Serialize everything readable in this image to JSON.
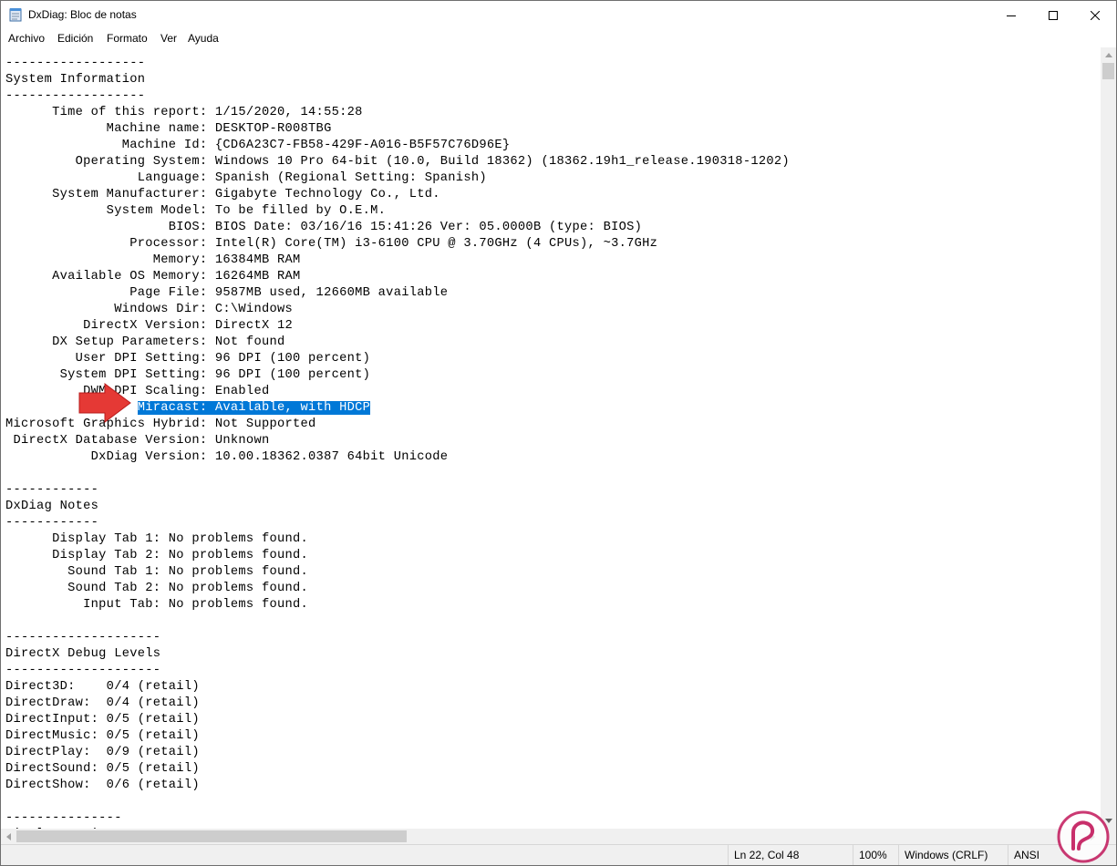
{
  "window": {
    "title": "DxDiag: Bloc de notas",
    "icon": "notepad-icon",
    "controls": [
      "minimize-icon",
      "maximize-icon",
      "close-icon"
    ]
  },
  "menu": {
    "items": [
      "Archivo",
      "Edición",
      "Formato",
      "Ver",
      "Ayuda"
    ]
  },
  "document": {
    "lines": [
      "------------------",
      "System Information",
      "------------------",
      "      Time of this report: 1/15/2020, 14:55:28",
      "             Machine name: DESKTOP-R008TBG",
      "               Machine Id: {CD6A23C7-FB58-429F-A016-B5F57C76D96E}",
      "         Operating System: Windows 10 Pro 64-bit (10.0, Build 18362) (18362.19h1_release.190318-1202)",
      "                 Language: Spanish (Regional Setting: Spanish)",
      "      System Manufacturer: Gigabyte Technology Co., Ltd.",
      "             System Model: To be filled by O.E.M.",
      "                     BIOS: BIOS Date: 03/16/16 15:41:26 Ver: 05.0000B (type: BIOS)",
      "                Processor: Intel(R) Core(TM) i3-6100 CPU @ 3.70GHz (4 CPUs), ~3.7GHz",
      "                   Memory: 16384MB RAM",
      "      Available OS Memory: 16264MB RAM",
      "                Page File: 9587MB used, 12660MB available",
      "              Windows Dir: C:\\Windows",
      "          DirectX Version: DirectX 12",
      "      DX Setup Parameters: Not found",
      "         User DPI Setting: 96 DPI (100 percent)",
      "       System DPI Setting: 96 DPI (100 percent)",
      "          DWM DPI Scaling: Enabled",
      {
        "pre": "                 ",
        "sel": "Miracast: Available, with HDCP"
      },
      "Microsoft Graphics Hybrid: Not Supported",
      " DirectX Database Version: Unknown",
      "           DxDiag Version: 10.00.18362.0387 64bit Unicode",
      "",
      "------------",
      "DxDiag Notes",
      "------------",
      "      Display Tab 1: No problems found.",
      "      Display Tab 2: No problems found.",
      "        Sound Tab 1: No problems found.",
      "        Sound Tab 2: No problems found.",
      "          Input Tab: No problems found.",
      "",
      "--------------------",
      "DirectX Debug Levels",
      "--------------------",
      "Direct3D:    0/4 (retail)",
      "DirectDraw:  0/4 (retail)",
      "DirectInput: 0/5 (retail)",
      "DirectMusic: 0/5 (retail)",
      "DirectPlay:  0/9 (retail)",
      "DirectSound: 0/5 (retail)",
      "DirectShow:  0/6 (retail)",
      "",
      "---------------",
      "Display Devices"
    ]
  },
  "status": {
    "position": "Ln 22, Col 48",
    "zoom": "100%",
    "line_ending": "Windows (CRLF)",
    "encoding": "ANSI"
  },
  "colors": {
    "selection": "#0078d7",
    "annotation_arrow": "#e53935",
    "watermark": "#c2185b"
  }
}
